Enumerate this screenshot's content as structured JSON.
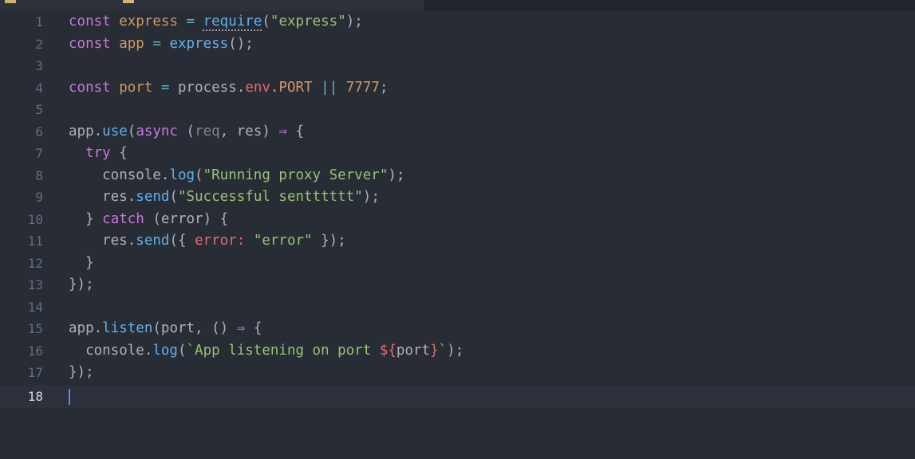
{
  "editor": {
    "lines": [
      {
        "num": "1"
      },
      {
        "num": "2"
      },
      {
        "num": "3"
      },
      {
        "num": "4"
      },
      {
        "num": "5"
      },
      {
        "num": "6"
      },
      {
        "num": "7"
      },
      {
        "num": "8"
      },
      {
        "num": "9"
      },
      {
        "num": "10"
      },
      {
        "num": "11"
      },
      {
        "num": "12"
      },
      {
        "num": "13"
      },
      {
        "num": "14"
      },
      {
        "num": "15"
      },
      {
        "num": "16"
      },
      {
        "num": "17"
      },
      {
        "num": "18"
      }
    ],
    "tokens": {
      "l1": [
        "const",
        " ",
        "express",
        " = ",
        "require",
        "(",
        "\"express\"",
        ");"
      ],
      "l2": [
        "const",
        " ",
        "app",
        " = ",
        "express",
        "();"
      ],
      "l4": [
        "const",
        " ",
        "port",
        " = ",
        "process",
        ".",
        "env",
        ".",
        "PORT",
        " || ",
        "7777",
        ";"
      ],
      "l6": [
        "app",
        ".",
        "use",
        "(",
        "async",
        " (",
        "req",
        ", ",
        "res",
        ") ",
        "⇒",
        " {"
      ],
      "l7": [
        "  ",
        "try",
        " {"
      ],
      "l8": [
        "    console.",
        "log",
        "(",
        "\"Running proxy Server\"",
        ");"
      ],
      "l9": [
        "    res.",
        "send",
        "(",
        "\"Successful sentttttt\"",
        ");"
      ],
      "l10": [
        "  } ",
        "catch",
        " (error) {"
      ],
      "l11": [
        "    res.",
        "send",
        "({ ",
        "error",
        ": ",
        "\"error\"",
        " });"
      ],
      "l12": [
        "  }"
      ],
      "l13": [
        "});"
      ],
      "l15": [
        "app.",
        "listen",
        "(port, () ",
        "⇒",
        " {"
      ],
      "l16": [
        "  console.",
        "log",
        "(",
        "`App listening on port ",
        "${",
        "port",
        "}",
        "`",
        ");"
      ],
      "l17": [
        "});"
      ]
    }
  }
}
